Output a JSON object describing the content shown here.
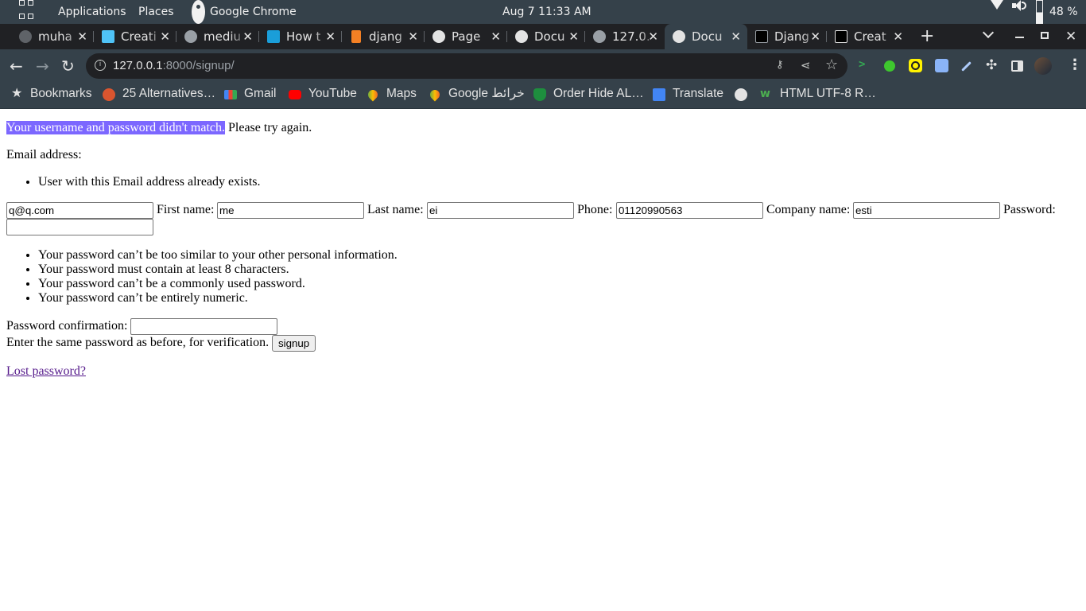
{
  "topbar": {
    "applications": "Applications",
    "places": "Places",
    "active_app": "Google Chrome",
    "clock": "Aug 7  11:33 AM",
    "battery": "48 %"
  },
  "tabs": [
    {
      "title": "muha",
      "icon": "github-icon"
    },
    {
      "title": "Creati",
      "icon": "cube-icon"
    },
    {
      "title": "mediu",
      "icon": "globe-icon"
    },
    {
      "title": "How t",
      "icon": "s-logo-icon"
    },
    {
      "title": "djang",
      "icon": "stackoverflow-icon"
    },
    {
      "title": "Page",
      "icon": "globe-icon"
    },
    {
      "title": "Docu",
      "icon": "globe-icon"
    },
    {
      "title": "127.0.",
      "icon": "globe-icon"
    },
    {
      "title": "Docu",
      "icon": "globe-icon",
      "active": true
    },
    {
      "title": "Djang",
      "icon": "medium-icon"
    },
    {
      "title": "Creat",
      "icon": "dev-icon"
    }
  ],
  "tab_close": "✕",
  "new_tab": "+",
  "address": {
    "host": "127.0.0.1",
    "path": ":8000/signup/"
  },
  "bookmarks": {
    "all": "Bookmarks",
    "items": [
      "25 Alternatives…",
      "Gmail",
      "YouTube",
      "Maps",
      "Google خرائط",
      "Order Hide AL…",
      "Translate",
      "",
      "HTML UTF-8 R…"
    ]
  },
  "form": {
    "nonfield_error_highlight": "Your username and password didn't match.",
    "nonfield_error_rest": " Please try again.",
    "email_label": "Email address:",
    "email_errors": [
      "User with this Email address already exists."
    ],
    "email_value": "q@q.com",
    "first_name_label": "First name:",
    "first_name_value": "me",
    "last_name_label": "Last name:",
    "last_name_value": "ei",
    "phone_label": "Phone:",
    "phone_value": "01120990563",
    "company_label": "Company name:",
    "company_value": "esti",
    "password_label": "Password:",
    "password_value": "",
    "password_help": [
      "Your password can’t be too similar to your other personal information.",
      "Your password must contain at least 8 characters.",
      "Your password can’t be a commonly used password.",
      "Your password can’t be entirely numeric."
    ],
    "password_confirm_label": "Password confirmation:",
    "password_confirm_help": "Enter the same password as before, for verification.",
    "submit_label": "signup",
    "lost_password": "Lost password?"
  }
}
